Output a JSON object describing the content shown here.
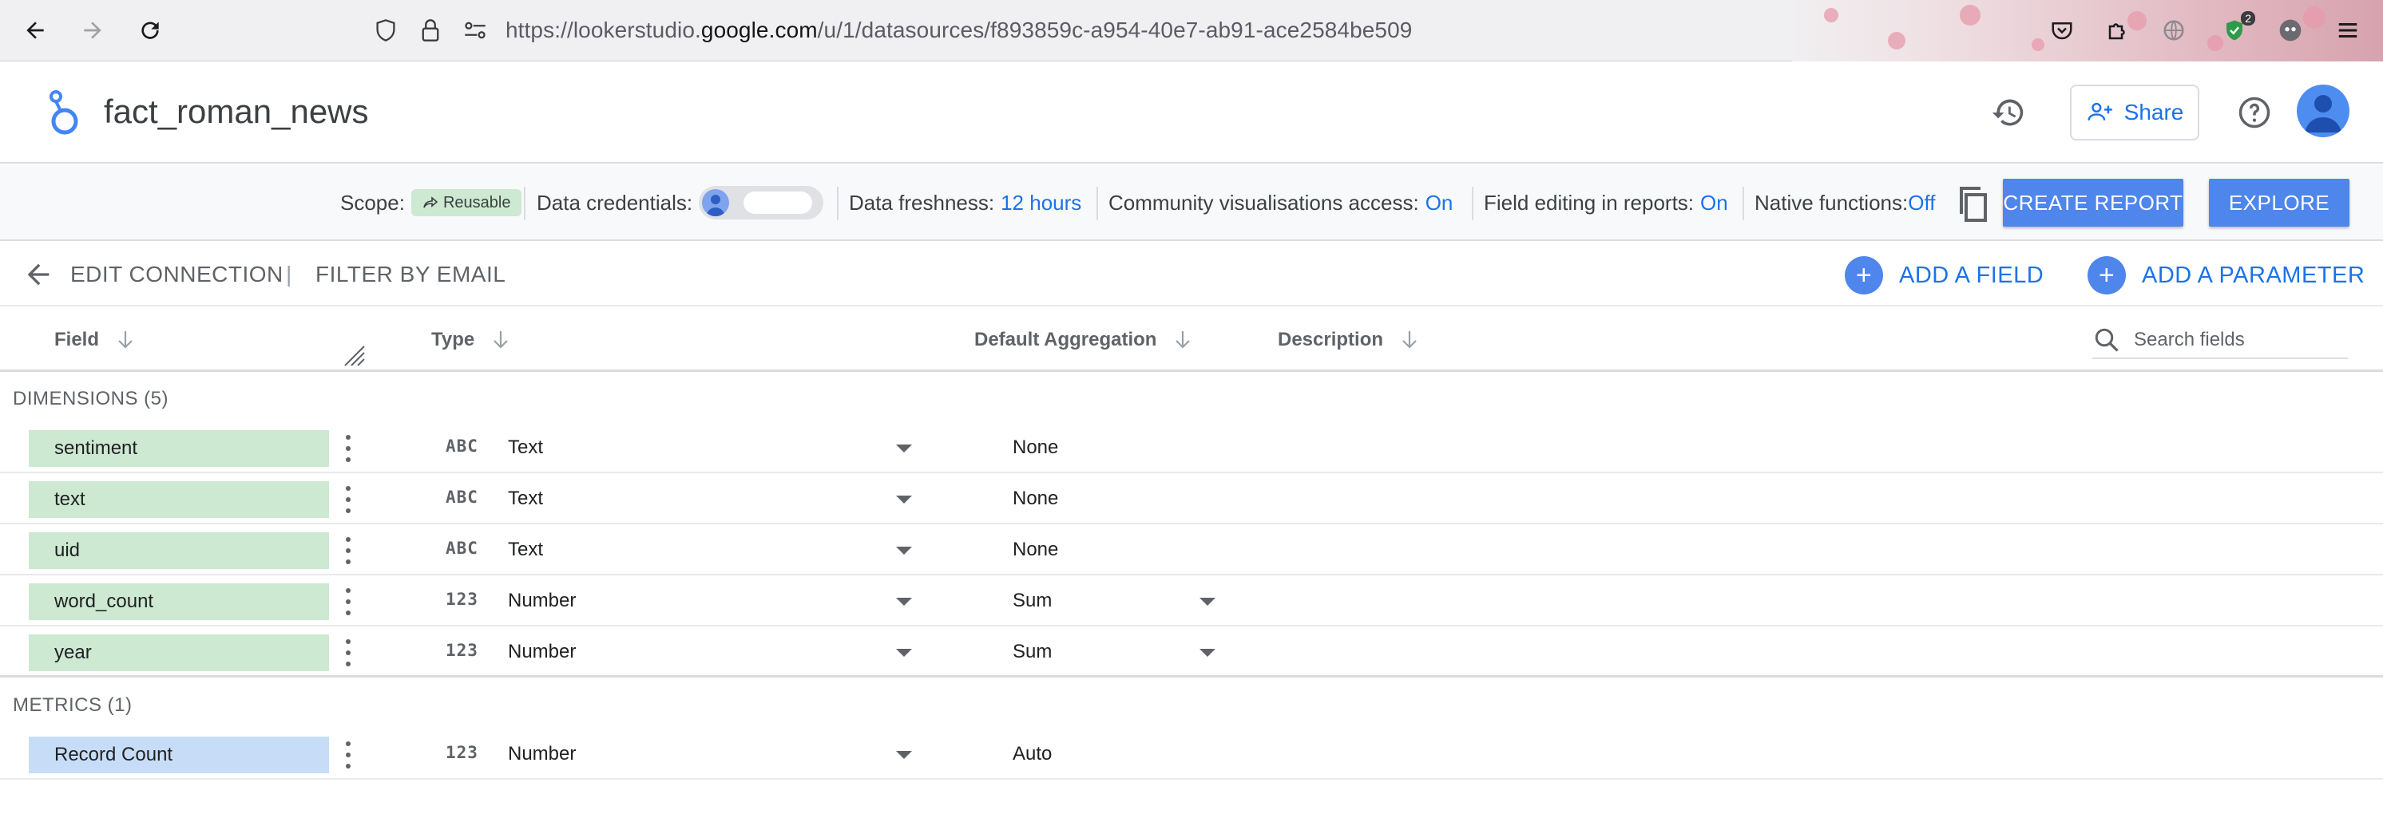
{
  "browser": {
    "url_prefix": "https://lookerstudio.",
    "url_domain": "google.com",
    "url_path": "/u/1/datasources/f893859c-a954-40e7-ab91-ace2584be509",
    "ext_badge_count": "2"
  },
  "header": {
    "title": "fact_roman_news",
    "share_label": "Share"
  },
  "settings": {
    "scope_label": "Scope:",
    "scope_chip": "Reusable",
    "credentials_label": "Data credentials:",
    "freshness_label": "Data freshness:",
    "freshness_value": "12 hours",
    "community_label": "Community visualisations access:",
    "community_value": "On",
    "field_editing_label": "Field editing in reports:",
    "field_editing_value": "On",
    "native_label": "Native functions:",
    "native_value": "Off",
    "create_report_label": "CREATE REPORT",
    "explore_label": "EXPLORE"
  },
  "connection": {
    "edit_label": "EDIT CONNECTION",
    "separator": "|",
    "filter_label": "FILTER BY EMAIL",
    "add_field_label": "ADD A FIELD",
    "add_parameter_label": "ADD A PARAMETER"
  },
  "table": {
    "col_field": "Field",
    "col_type": "Type",
    "col_agg": "Default Aggregation",
    "col_desc": "Description",
    "search_placeholder": "Search fields"
  },
  "dimensions": {
    "label": "DIMENSIONS (5)",
    "rows": [
      {
        "name": "sentiment",
        "type_code": "ABC",
        "type": "Text",
        "agg": "None",
        "agg_dropdown": false
      },
      {
        "name": "text",
        "type_code": "ABC",
        "type": "Text",
        "agg": "None",
        "agg_dropdown": false
      },
      {
        "name": "uid",
        "type_code": "ABC",
        "type": "Text",
        "agg": "None",
        "agg_dropdown": false
      },
      {
        "name": "word_count",
        "type_code": "123",
        "type": "Number",
        "agg": "Sum",
        "agg_dropdown": true
      },
      {
        "name": "year",
        "type_code": "123",
        "type": "Number",
        "agg": "Sum",
        "agg_dropdown": true
      }
    ]
  },
  "metrics": {
    "label": "METRICS (1)",
    "rows": [
      {
        "name": "Record Count",
        "type_code": "123",
        "type": "Number",
        "agg": "Auto",
        "agg_dropdown": false
      }
    ]
  },
  "colors": {
    "accent": "#1a73e8",
    "button_blue": "#4f86ec",
    "dimension_green": "#cde9d1",
    "metric_blue": "#c7ddf7"
  }
}
